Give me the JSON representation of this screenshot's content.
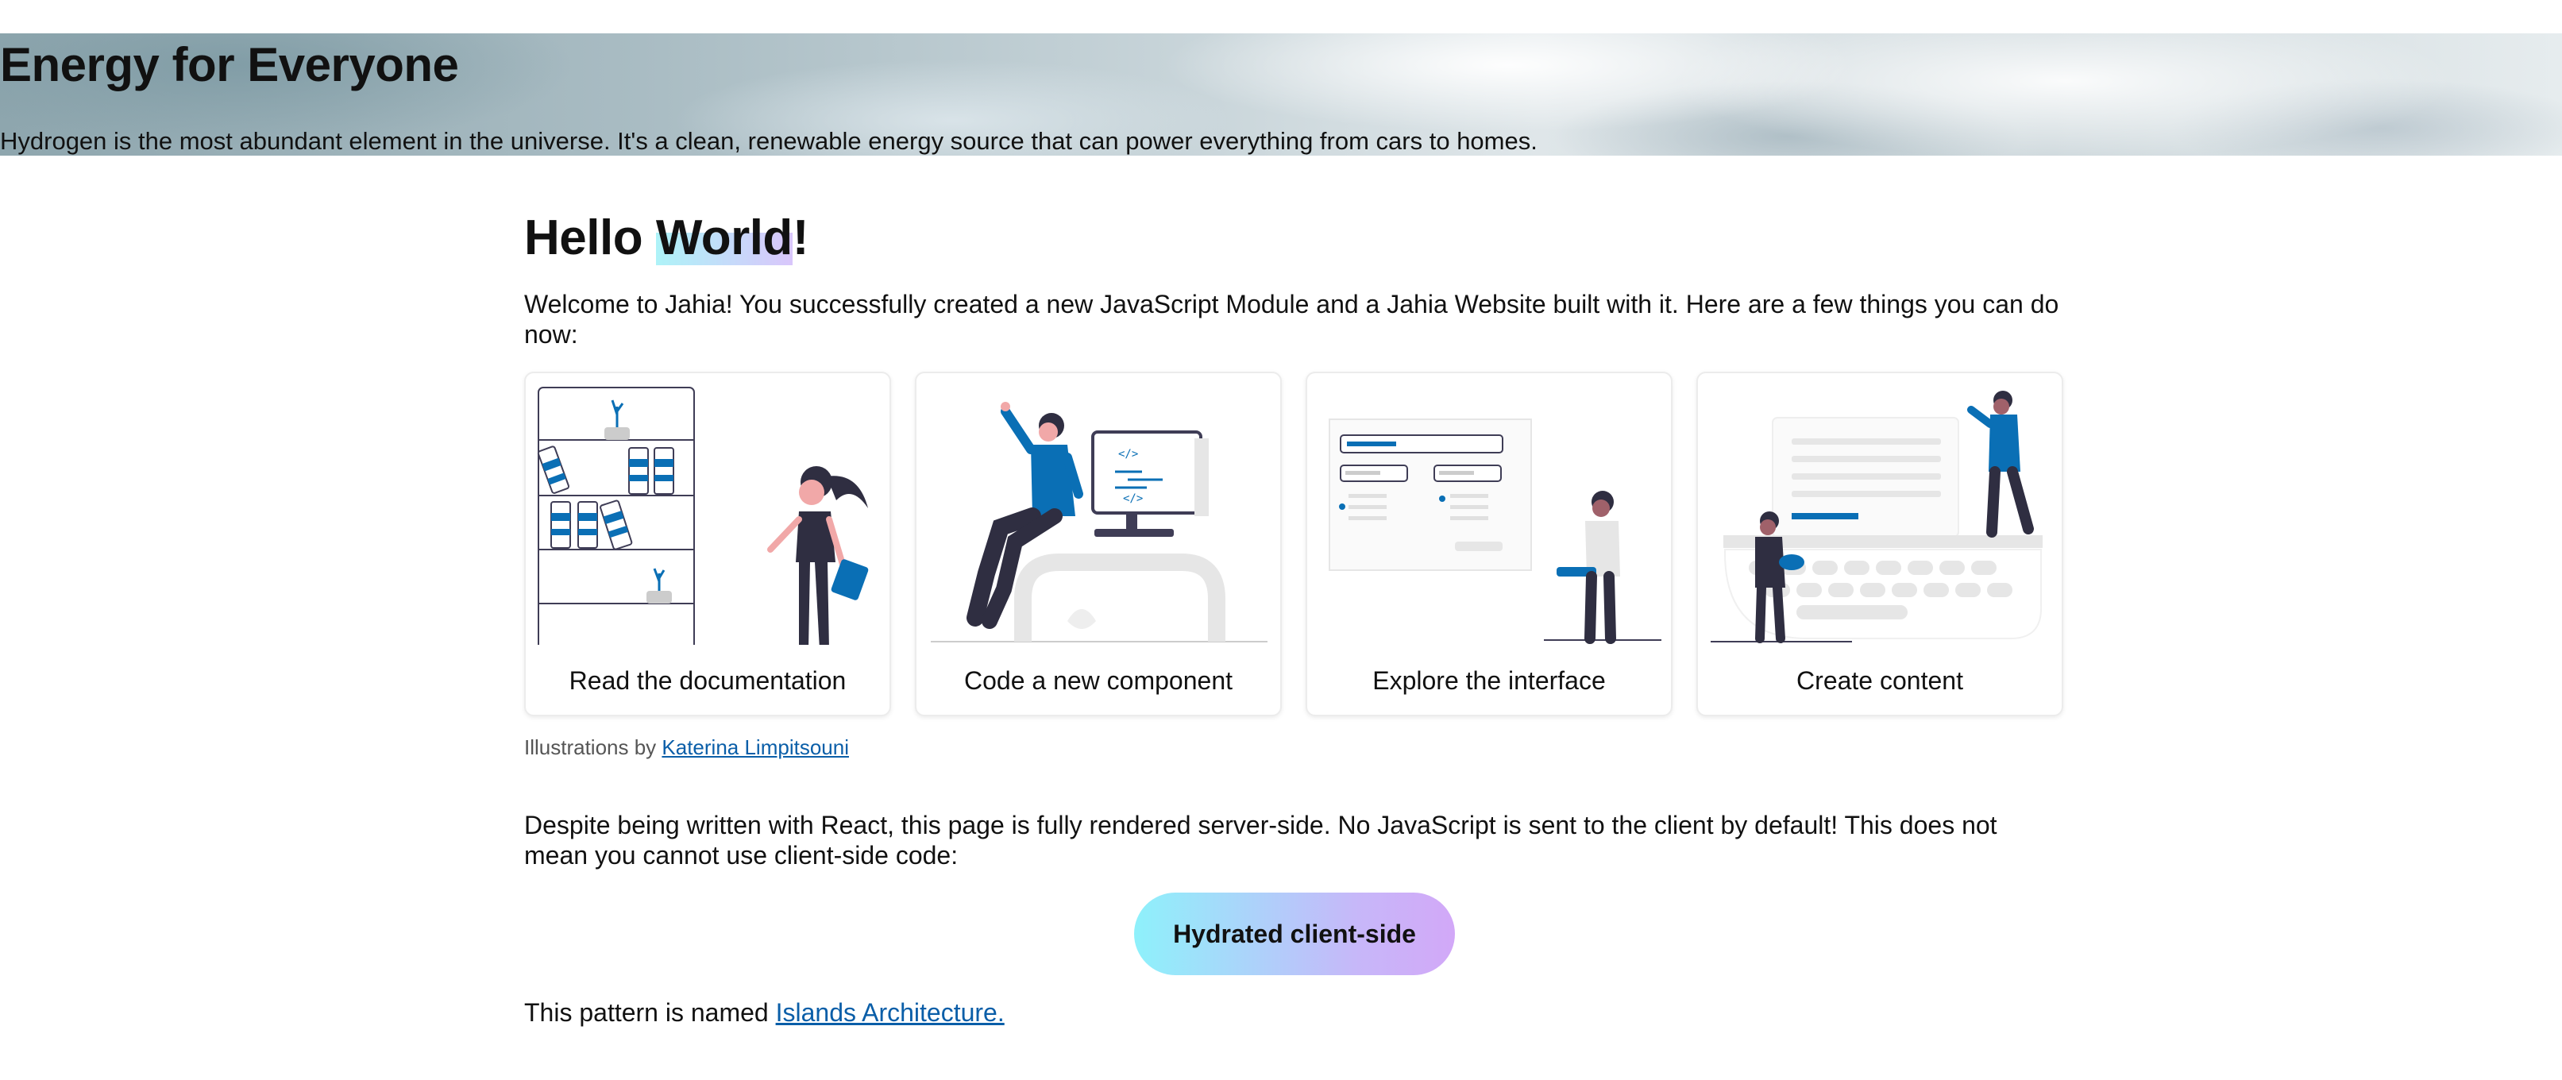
{
  "hero": {
    "title": "Energy for Everyone",
    "subtitle": "Hydrogen is the most abundant element in the universe. It's a clean, renewable energy source that can power everything from cars to homes."
  },
  "main": {
    "heading_prefix": "Hello ",
    "heading_highlight": "World",
    "heading_suffix": "!",
    "welcome": "Welcome to Jahia! You successfully created a new JavaScript Module and a Jahia Website built with it. Here are a few things you can do now:",
    "cards": [
      {
        "label": "Read the documentation"
      },
      {
        "label": "Code a new component"
      },
      {
        "label": "Explore the interface"
      },
      {
        "label": "Create content"
      }
    ],
    "credit_prefix": "Illustrations by ",
    "credit_link": "Katerina Limpitsouni",
    "despite": "Despite being written with React, this page is fully rendered server-side. No JavaScript is sent to the client by default! This does not mean you cannot use client-side code:",
    "hydrate_button": "Hydrated client-side",
    "pattern_prefix": "This pattern is named ",
    "pattern_link": "Islands Architecture."
  },
  "colors": {
    "accent_blue": "#0a6fb5",
    "link": "#0a5ea8",
    "gradient_start": "#8ef1fb",
    "gradient_end": "#d2a8f8"
  }
}
